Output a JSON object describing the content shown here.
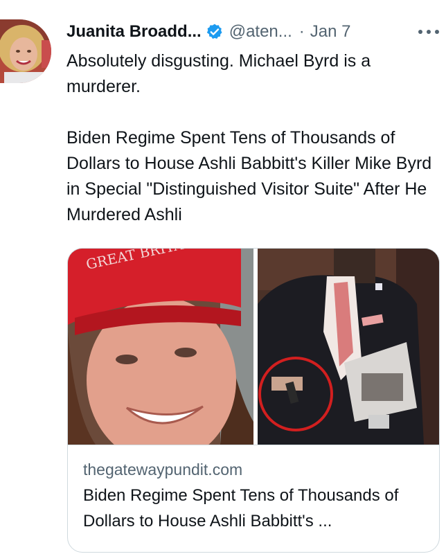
{
  "author": {
    "name": "Juanita Broadd...",
    "handle": "@aten...",
    "separator": "·",
    "date": "Jan 7"
  },
  "tweet": {
    "lines": [
      "Absolutely disgusting.  Michael Byrd is a murderer.",
      "Biden Regime Spent Tens of Thousands of Dollars to House Ashli Babbitt's Killer Mike Byrd in Special \"Distinguished Visitor Suite\" After He Murdered Ashli"
    ]
  },
  "card": {
    "cap_text": "GREAT BRITAIN",
    "domain": "thegatewaypundit.com",
    "title": "Biden Regime Spent Tens of Thousands of Dollars to House Ashli Babbitt's ..."
  },
  "icons": {
    "verified": "verified-badge-icon",
    "more": "more-options-icon"
  },
  "colors": {
    "verified_blue": "#1d9bf0",
    "secondary_text": "#536471",
    "border": "#cfd9de",
    "circle_annotation": "#d21f1f"
  }
}
